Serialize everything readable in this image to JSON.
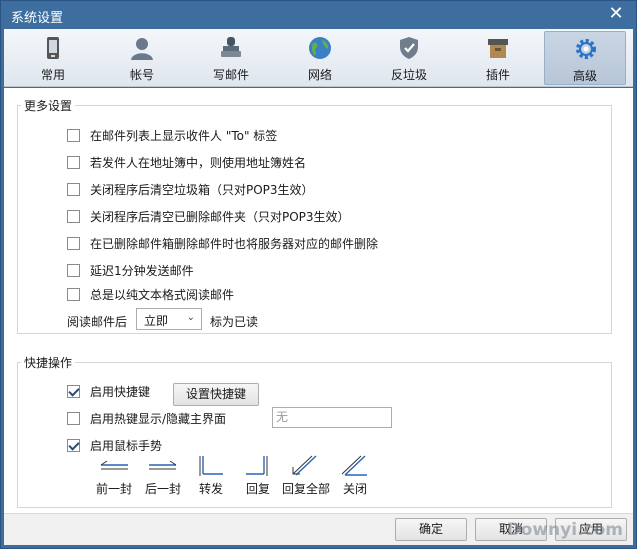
{
  "window": {
    "title": "系统设置"
  },
  "toolbar": {
    "items": [
      {
        "label": "常用",
        "icon": "phone-icon"
      },
      {
        "label": "帐号",
        "icon": "user-icon"
      },
      {
        "label": "写邮件",
        "icon": "stamp-icon"
      },
      {
        "label": "网络",
        "icon": "globe-icon"
      },
      {
        "label": "反垃圾",
        "icon": "shield-icon"
      },
      {
        "label": "插件",
        "icon": "box-icon"
      },
      {
        "label": "高级",
        "icon": "gear-icon",
        "active": true
      }
    ]
  },
  "more_settings": {
    "title": "更多设置",
    "options": [
      {
        "label": "在邮件列表上显示收件人 \"To\" 标签",
        "checked": false
      },
      {
        "label": "若发件人在地址簿中，则使用地址簿姓名",
        "checked": false
      },
      {
        "label": "关闭程序后清空垃圾箱（只对POP3生效）",
        "checked": false
      },
      {
        "label": "关闭程序后清空已删除邮件夹（只对POP3生效）",
        "checked": false
      },
      {
        "label": "在已删除邮件箱删除邮件时也将服务器对应的邮件删除",
        "checked": false
      },
      {
        "label": "延迟1分钟发送邮件",
        "checked": false
      },
      {
        "label": "总是以纯文本格式阅读邮件",
        "checked": false
      }
    ],
    "read_prefix": "阅读邮件后",
    "read_select": "立即",
    "read_suffix": "标为已读"
  },
  "shortcuts": {
    "title": "快捷操作",
    "enable_hotkey": {
      "label": "启用快捷键",
      "checked": true
    },
    "set_hotkey_button": "设置快捷键",
    "hotkey_show": {
      "label": "启用热键显示/隐藏主界面",
      "checked": false
    },
    "hotkey_value": "无",
    "mouse_gesture": {
      "label": "启用鼠标手势",
      "checked": true
    },
    "gestures": [
      "前一封",
      "后一封",
      "转发",
      "回复",
      "回复全部",
      "关闭"
    ]
  },
  "footer": {
    "ok": "确定",
    "cancel": "取消",
    "apply": "应用",
    "watermark": "Downyi.com"
  },
  "colors": {
    "accent": "#3d6e9f",
    "gesture_blue": "#2a63b8"
  }
}
